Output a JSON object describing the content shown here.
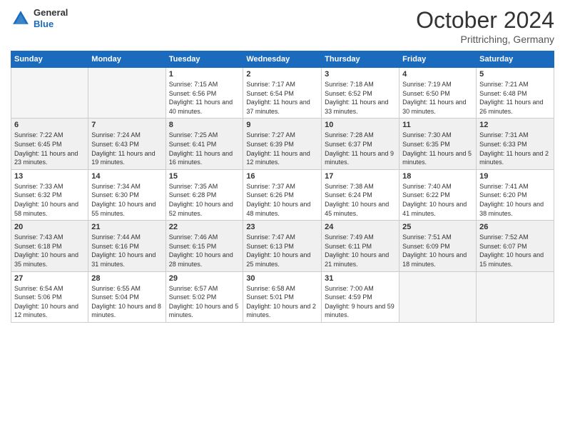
{
  "header": {
    "logo_general": "General",
    "logo_blue": "Blue",
    "month_title": "October 2024",
    "subtitle": "Prittriching, Germany"
  },
  "weekdays": [
    "Sunday",
    "Monday",
    "Tuesday",
    "Wednesday",
    "Thursday",
    "Friday",
    "Saturday"
  ],
  "weeks": [
    [
      {
        "day": "",
        "empty": true
      },
      {
        "day": "",
        "empty": true
      },
      {
        "day": "1",
        "sunrise": "Sunrise: 7:15 AM",
        "sunset": "Sunset: 6:56 PM",
        "daylight": "Daylight: 11 hours and 40 minutes."
      },
      {
        "day": "2",
        "sunrise": "Sunrise: 7:17 AM",
        "sunset": "Sunset: 6:54 PM",
        "daylight": "Daylight: 11 hours and 37 minutes."
      },
      {
        "day": "3",
        "sunrise": "Sunrise: 7:18 AM",
        "sunset": "Sunset: 6:52 PM",
        "daylight": "Daylight: 11 hours and 33 minutes."
      },
      {
        "day": "4",
        "sunrise": "Sunrise: 7:19 AM",
        "sunset": "Sunset: 6:50 PM",
        "daylight": "Daylight: 11 hours and 30 minutes."
      },
      {
        "day": "5",
        "sunrise": "Sunrise: 7:21 AM",
        "sunset": "Sunset: 6:48 PM",
        "daylight": "Daylight: 11 hours and 26 minutes."
      }
    ],
    [
      {
        "day": "6",
        "sunrise": "Sunrise: 7:22 AM",
        "sunset": "Sunset: 6:45 PM",
        "daylight": "Daylight: 11 hours and 23 minutes."
      },
      {
        "day": "7",
        "sunrise": "Sunrise: 7:24 AM",
        "sunset": "Sunset: 6:43 PM",
        "daylight": "Daylight: 11 hours and 19 minutes."
      },
      {
        "day": "8",
        "sunrise": "Sunrise: 7:25 AM",
        "sunset": "Sunset: 6:41 PM",
        "daylight": "Daylight: 11 hours and 16 minutes."
      },
      {
        "day": "9",
        "sunrise": "Sunrise: 7:27 AM",
        "sunset": "Sunset: 6:39 PM",
        "daylight": "Daylight: 11 hours and 12 minutes."
      },
      {
        "day": "10",
        "sunrise": "Sunrise: 7:28 AM",
        "sunset": "Sunset: 6:37 PM",
        "daylight": "Daylight: 11 hours and 9 minutes."
      },
      {
        "day": "11",
        "sunrise": "Sunrise: 7:30 AM",
        "sunset": "Sunset: 6:35 PM",
        "daylight": "Daylight: 11 hours and 5 minutes."
      },
      {
        "day": "12",
        "sunrise": "Sunrise: 7:31 AM",
        "sunset": "Sunset: 6:33 PM",
        "daylight": "Daylight: 11 hours and 2 minutes."
      }
    ],
    [
      {
        "day": "13",
        "sunrise": "Sunrise: 7:33 AM",
        "sunset": "Sunset: 6:32 PM",
        "daylight": "Daylight: 10 hours and 58 minutes."
      },
      {
        "day": "14",
        "sunrise": "Sunrise: 7:34 AM",
        "sunset": "Sunset: 6:30 PM",
        "daylight": "Daylight: 10 hours and 55 minutes."
      },
      {
        "day": "15",
        "sunrise": "Sunrise: 7:35 AM",
        "sunset": "Sunset: 6:28 PM",
        "daylight": "Daylight: 10 hours and 52 minutes."
      },
      {
        "day": "16",
        "sunrise": "Sunrise: 7:37 AM",
        "sunset": "Sunset: 6:26 PM",
        "daylight": "Daylight: 10 hours and 48 minutes."
      },
      {
        "day": "17",
        "sunrise": "Sunrise: 7:38 AM",
        "sunset": "Sunset: 6:24 PM",
        "daylight": "Daylight: 10 hours and 45 minutes."
      },
      {
        "day": "18",
        "sunrise": "Sunrise: 7:40 AM",
        "sunset": "Sunset: 6:22 PM",
        "daylight": "Daylight: 10 hours and 41 minutes."
      },
      {
        "day": "19",
        "sunrise": "Sunrise: 7:41 AM",
        "sunset": "Sunset: 6:20 PM",
        "daylight": "Daylight: 10 hours and 38 minutes."
      }
    ],
    [
      {
        "day": "20",
        "sunrise": "Sunrise: 7:43 AM",
        "sunset": "Sunset: 6:18 PM",
        "daylight": "Daylight: 10 hours and 35 minutes."
      },
      {
        "day": "21",
        "sunrise": "Sunrise: 7:44 AM",
        "sunset": "Sunset: 6:16 PM",
        "daylight": "Daylight: 10 hours and 31 minutes."
      },
      {
        "day": "22",
        "sunrise": "Sunrise: 7:46 AM",
        "sunset": "Sunset: 6:15 PM",
        "daylight": "Daylight: 10 hours and 28 minutes."
      },
      {
        "day": "23",
        "sunrise": "Sunrise: 7:47 AM",
        "sunset": "Sunset: 6:13 PM",
        "daylight": "Daylight: 10 hours and 25 minutes."
      },
      {
        "day": "24",
        "sunrise": "Sunrise: 7:49 AM",
        "sunset": "Sunset: 6:11 PM",
        "daylight": "Daylight: 10 hours and 21 minutes."
      },
      {
        "day": "25",
        "sunrise": "Sunrise: 7:51 AM",
        "sunset": "Sunset: 6:09 PM",
        "daylight": "Daylight: 10 hours and 18 minutes."
      },
      {
        "day": "26",
        "sunrise": "Sunrise: 7:52 AM",
        "sunset": "Sunset: 6:07 PM",
        "daylight": "Daylight: 10 hours and 15 minutes."
      }
    ],
    [
      {
        "day": "27",
        "sunrise": "Sunrise: 6:54 AM",
        "sunset": "Sunset: 5:06 PM",
        "daylight": "Daylight: 10 hours and 12 minutes."
      },
      {
        "day": "28",
        "sunrise": "Sunrise: 6:55 AM",
        "sunset": "Sunset: 5:04 PM",
        "daylight": "Daylight: 10 hours and 8 minutes."
      },
      {
        "day": "29",
        "sunrise": "Sunrise: 6:57 AM",
        "sunset": "Sunset: 5:02 PM",
        "daylight": "Daylight: 10 hours and 5 minutes."
      },
      {
        "day": "30",
        "sunrise": "Sunrise: 6:58 AM",
        "sunset": "Sunset: 5:01 PM",
        "daylight": "Daylight: 10 hours and 2 minutes."
      },
      {
        "day": "31",
        "sunrise": "Sunrise: 7:00 AM",
        "sunset": "Sunset: 4:59 PM",
        "daylight": "Daylight: 9 hours and 59 minutes."
      },
      {
        "day": "",
        "empty": true
      },
      {
        "day": "",
        "empty": true
      }
    ]
  ]
}
